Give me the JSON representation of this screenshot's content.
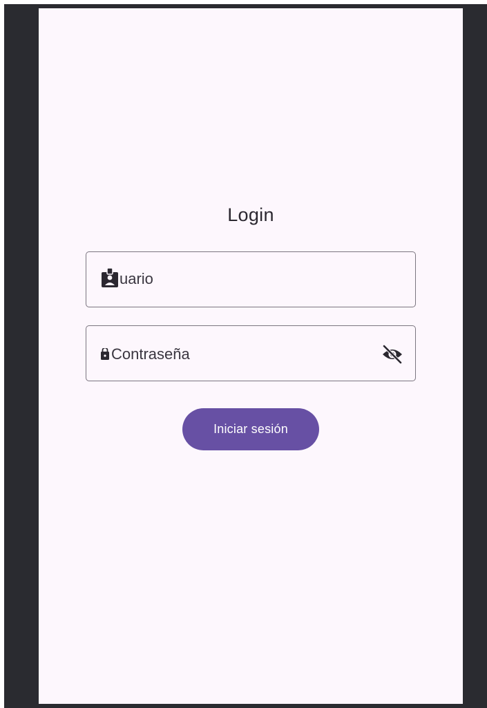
{
  "login": {
    "title": "Login",
    "username_field": {
      "value": "uario",
      "icon": "badge-icon"
    },
    "password_field": {
      "value": "Contraseña",
      "icon": "lock-icon",
      "toggle_icon": "visibility-off-icon"
    },
    "submit_label": "Iniciar sesión"
  },
  "colors": {
    "frame": "#2a2b30",
    "background": "#fdf7fd",
    "accent": "#6750a4",
    "text": "#2b2830",
    "outline": "#7a757f"
  }
}
